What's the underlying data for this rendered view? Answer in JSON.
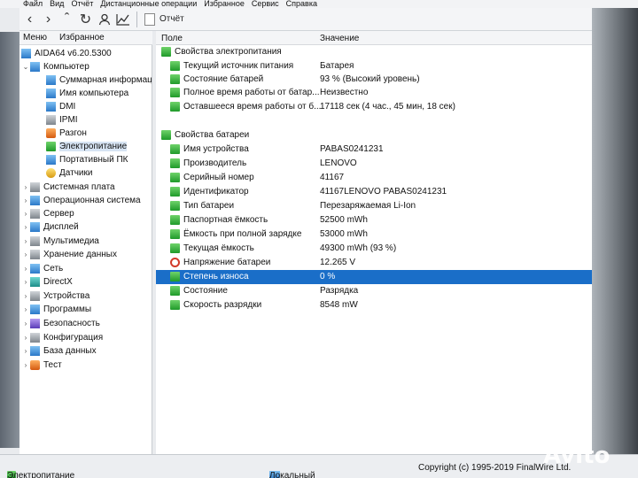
{
  "menu": [
    "Файл",
    "Вид",
    "Отчёт",
    "Дистанционные операции",
    "Избранное",
    "Сервис",
    "Справка"
  ],
  "toolbar": {
    "report_label": "Отчёт"
  },
  "left_tabs": {
    "menu": "Меню",
    "favorites": "Избранное"
  },
  "tree": {
    "root": "AIDA64 v6.20.5300",
    "items": [
      {
        "label": "Компьютер",
        "icon": "computer-icon"
      },
      {
        "label": "Суммарная информация",
        "icon": "summary-icon"
      },
      {
        "label": "Имя компьютера",
        "icon": "computer-name-icon"
      },
      {
        "label": "DMI",
        "icon": "dmi-icon"
      },
      {
        "label": "IPMI",
        "icon": "ipmi-icon"
      },
      {
        "label": "Разгон",
        "icon": "overclock-icon"
      },
      {
        "label": "Электропитание",
        "icon": "power-icon"
      },
      {
        "label": "Портативный ПК",
        "icon": "laptop-icon"
      },
      {
        "label": "Датчики",
        "icon": "sensor-icon"
      },
      {
        "label": "Системная плата",
        "icon": "motherboard-icon"
      },
      {
        "label": "Операционная система",
        "icon": "os-icon"
      },
      {
        "label": "Сервер",
        "icon": "server-icon"
      },
      {
        "label": "Дисплей",
        "icon": "display-icon"
      },
      {
        "label": "Мультимедиа",
        "icon": "multimedia-icon"
      },
      {
        "label": "Хранение данных",
        "icon": "storage-icon"
      },
      {
        "label": "Сеть",
        "icon": "network-icon"
      },
      {
        "label": "DirectX",
        "icon": "directx-icon"
      },
      {
        "label": "Устройства",
        "icon": "devices-icon"
      },
      {
        "label": "Программы",
        "icon": "programs-icon"
      },
      {
        "label": "Безопасность",
        "icon": "security-icon"
      },
      {
        "label": "Конфигурация",
        "icon": "config-icon"
      },
      {
        "label": "База данных",
        "icon": "database-icon"
      },
      {
        "label": "Тест",
        "icon": "test-icon"
      }
    ]
  },
  "columns": {
    "field": "Поле",
    "value": "Значение"
  },
  "sections": {
    "power": {
      "title": "Свойства электропитания",
      "rows": [
        {
          "name": "Текущий источник питания",
          "value": "Батарея"
        },
        {
          "name": "Состояние батарей",
          "value": "93 % (Высокий уровень)"
        },
        {
          "name": "Полное время работы от батар...",
          "value": "Неизвестно"
        },
        {
          "name": "Оставшееся время работы от б...",
          "value": "17118 сек (4 час., 45 мин, 18 сек)"
        }
      ]
    },
    "battery": {
      "title": "Свойства батареи",
      "rows": [
        {
          "name": "Имя устройства",
          "value": "PABAS0241231"
        },
        {
          "name": "Производитель",
          "value": "LENOVO"
        },
        {
          "name": "Серийный номер",
          "value": "41167"
        },
        {
          "name": "Идентификатор",
          "value": "41167LENOVO PABAS0241231"
        },
        {
          "name": "Тип батареи",
          "value": "Перезаряжаемая Li-Ion"
        },
        {
          "name": "Паспортная ёмкость",
          "value": "52500 mWh"
        },
        {
          "name": "Ёмкость при полной зарядке",
          "value": "53000 mWh"
        },
        {
          "name": "Текущая ёмкость",
          "value": "49300 mWh  (93 %)"
        },
        {
          "name": "Напряжение батареи",
          "value": "12.265 V"
        },
        {
          "name": "Степень износа",
          "value": "0 %"
        },
        {
          "name": "Состояние",
          "value": "Разрядка"
        },
        {
          "name": "Скорость разрядки",
          "value": "8548 mW"
        }
      ]
    }
  },
  "status": {
    "left": "Электропитание",
    "middle": "Локальный",
    "right": "Copyright (c) 1995-2019 FinalWire Ltd."
  },
  "watermark": "Avito"
}
